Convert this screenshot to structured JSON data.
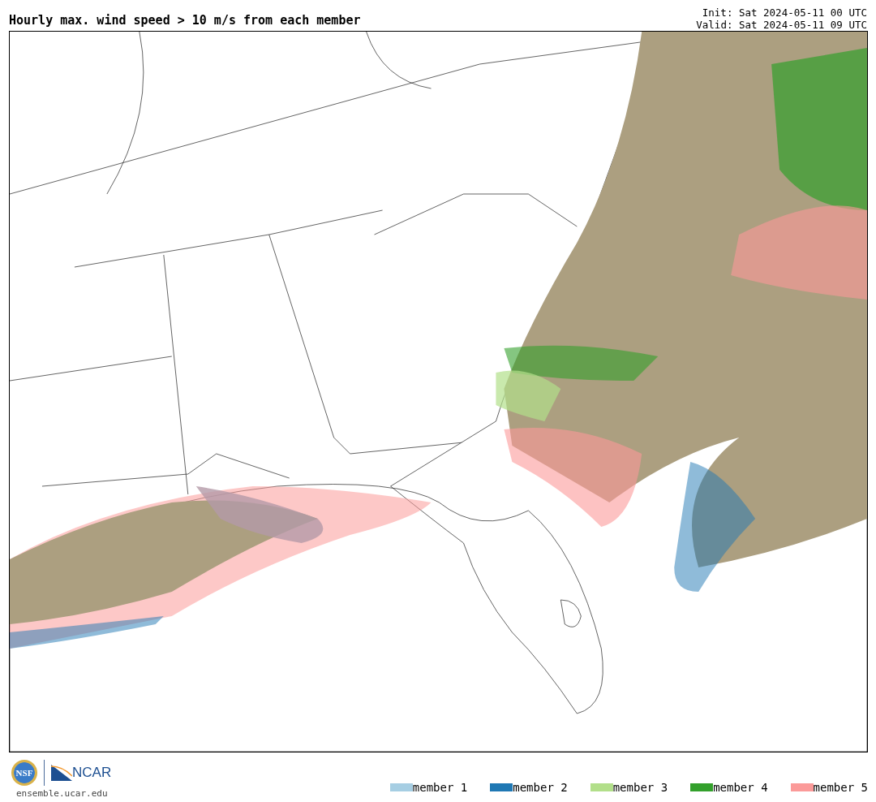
{
  "title": "Hourly max. wind speed > 10 m/s from each member",
  "init": "Init: Sat 2024-05-11 00 UTC",
  "valid": "Valid: Sat 2024-05-11 09 UTC",
  "logos": {
    "nsf": "NSF",
    "ncar": "NCAR"
  },
  "site": "ensemble.ucar.edu",
  "legend": [
    {
      "label": "member 1",
      "color": "#a6cee3"
    },
    {
      "label": "member 2",
      "color": "#1f78b4"
    },
    {
      "label": "member 3",
      "color": "#b2df8a"
    },
    {
      "label": "member 4",
      "color": "#33a02c"
    },
    {
      "label": "member 5",
      "color": "#fb9a99"
    }
  ]
}
